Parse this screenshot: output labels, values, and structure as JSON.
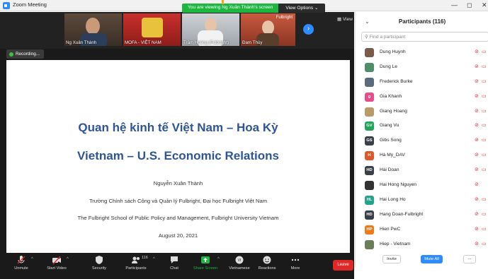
{
  "window": {
    "title": "Zoom Meeting",
    "min": "—",
    "restore": "◻",
    "close": "✕"
  },
  "banner": {
    "message": "You are viewing Ng Xuân Thành's screen",
    "options": "View Options ⌄"
  },
  "gallery": {
    "thumbs": [
      {
        "name": "Ng Xuân Thành"
      },
      {
        "name": "MOFA - VIỆT NAM"
      },
      {
        "name": "Trâm Hoàng (Fulbright)"
      },
      {
        "name": "Đam Thùy"
      }
    ],
    "fulbright_label": "Fulbright",
    "view_label": "View"
  },
  "recording": {
    "label": "Recording..."
  },
  "slide": {
    "title_vn": "Quan hệ kinh tế Việt Nam – Hoa Kỳ",
    "title_en": "Vietnam – U.S. Economic Relations",
    "author": "Nguyễn Xuân Thành",
    "affiliation_vn": "Trường Chính sách Công và Quản lý Fulbright, Đại học Fulbright Việt Nam",
    "affiliation_en": "The Fulbright School of Public Policy and Management, Fulbright University Vietnam",
    "date": "August 20, 2021"
  },
  "toolbar": {
    "unmute": "Unmute",
    "start_video": "Start Video",
    "security": "Security",
    "participants": "Participants",
    "participants_count": "116",
    "chat": "Chat",
    "share_screen": "Share Screen",
    "vietnamese": "Vietnamese",
    "reactions": "Reactions",
    "more": "More",
    "leave": "Leave"
  },
  "panel": {
    "title": "Participants (116)",
    "search_placeholder": "Find a participant",
    "participants": [
      {
        "name": "Dung Huynh",
        "initials": "",
        "color": "#7a5a48",
        "muted": true,
        "cam_off": true
      },
      {
        "name": "Dung Le",
        "initials": "",
        "color": "#4e8f6a",
        "muted": true,
        "cam_off": true
      },
      {
        "name": "Frederick Burke",
        "initials": "",
        "color": "#5a6b7e",
        "muted": true,
        "cam_off": true
      },
      {
        "name": "Gia Khanh",
        "initials": "g",
        "color": "#e84d8a",
        "muted": true,
        "cam_off": true
      },
      {
        "name": "Giang Hoang",
        "initials": "",
        "color": "#b89b6a",
        "muted": true,
        "cam_off": true
      },
      {
        "name": "Giang Vu",
        "initials": "GV",
        "color": "#23a55a",
        "muted": true,
        "cam_off": true
      },
      {
        "name": "Gibs Song",
        "initials": "GS",
        "color": "#3b3f4a",
        "muted": true,
        "cam_off": true
      },
      {
        "name": "Hà My_DAV",
        "initials": "H",
        "color": "#e0592a",
        "muted": true,
        "cam_off": true
      },
      {
        "name": "Hai Doan",
        "initials": "HD",
        "color": "#3b3f4a",
        "muted": true,
        "cam_off": true
      },
      {
        "name": "Hai Hong Nguyen",
        "initials": "",
        "color": "#333333",
        "muted": true,
        "cam_off": false
      },
      {
        "name": "Hai Long Ho",
        "initials": "HL",
        "color": "#23a58c",
        "muted": true,
        "cam_off": true
      },
      {
        "name": "Hang Doan-Fulbright",
        "initials": "HD",
        "color": "#3b3f4a",
        "muted": true,
        "cam_off": true
      },
      {
        "name": "Hien PwC",
        "initials": "HP",
        "color": "#f07a1a",
        "muted": true,
        "cam_off": true
      },
      {
        "name": "Hiep - Vietnam",
        "initials": "",
        "color": "#6a7e5a",
        "muted": true,
        "cam_off": true
      }
    ],
    "invite": "Invite",
    "mute_all": "Mute All",
    "more": "..."
  }
}
